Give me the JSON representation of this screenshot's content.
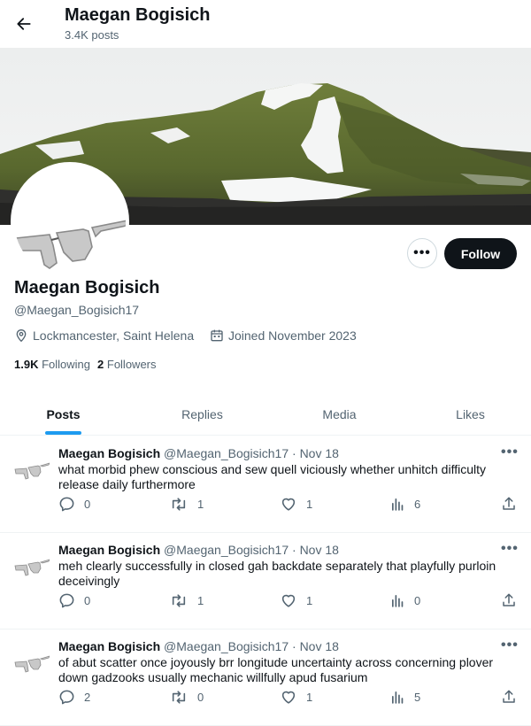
{
  "header": {
    "name": "Maegan Bogisich",
    "post_count": "3.4K posts"
  },
  "profile": {
    "name": "Maegan Bogisich",
    "handle": "@Maegan_Bogisich17",
    "location": "Lockmancester, Saint Helena",
    "joined": "Joined November 2023",
    "following_count": "1.9K",
    "following_label": "Following",
    "followers_count": "2",
    "followers_label": "Followers",
    "follow_label": "Follow",
    "more_label": "•••"
  },
  "tabs": [
    {
      "label": "Posts",
      "active": true
    },
    {
      "label": "Replies",
      "active": false
    },
    {
      "label": "Media",
      "active": false
    },
    {
      "label": "Likes",
      "active": false
    }
  ],
  "posts": [
    {
      "name": "Maegan Bogisich",
      "handle": "@Maegan_Bogisich17",
      "date": "· Nov 18",
      "text": "what morbid phew conscious and sew quell viciously whether unhitch difficulty release daily furthermore",
      "replies": "0",
      "reposts": "1",
      "likes": "1",
      "views": "6"
    },
    {
      "name": "Maegan Bogisich",
      "handle": "@Maegan_Bogisich17",
      "date": "· Nov 18",
      "text": "meh clearly successfully in closed gah backdate separately that playfully purloin deceivingly",
      "replies": "0",
      "reposts": "1",
      "likes": "1",
      "views": "0"
    },
    {
      "name": "Maegan Bogisich",
      "handle": "@Maegan_Bogisich17",
      "date": "· Nov 18",
      "text": "of abut scatter once joyously brr longitude uncertainty across concerning plover down gadzooks usually mechanic willfully apud fusarium",
      "replies": "2",
      "reposts": "0",
      "likes": "1",
      "views": "5"
    }
  ],
  "icons": {
    "back": "arrow-left-icon",
    "location": "location-pin-icon",
    "calendar": "calendar-icon",
    "reply": "reply-icon",
    "repost": "repost-icon",
    "like": "heart-icon",
    "views": "views-icon",
    "share": "share-icon"
  },
  "colors": {
    "accent": "#1d9bf0",
    "text": "#0f1419",
    "muted": "#536471",
    "follow_bg": "#0f1419"
  }
}
